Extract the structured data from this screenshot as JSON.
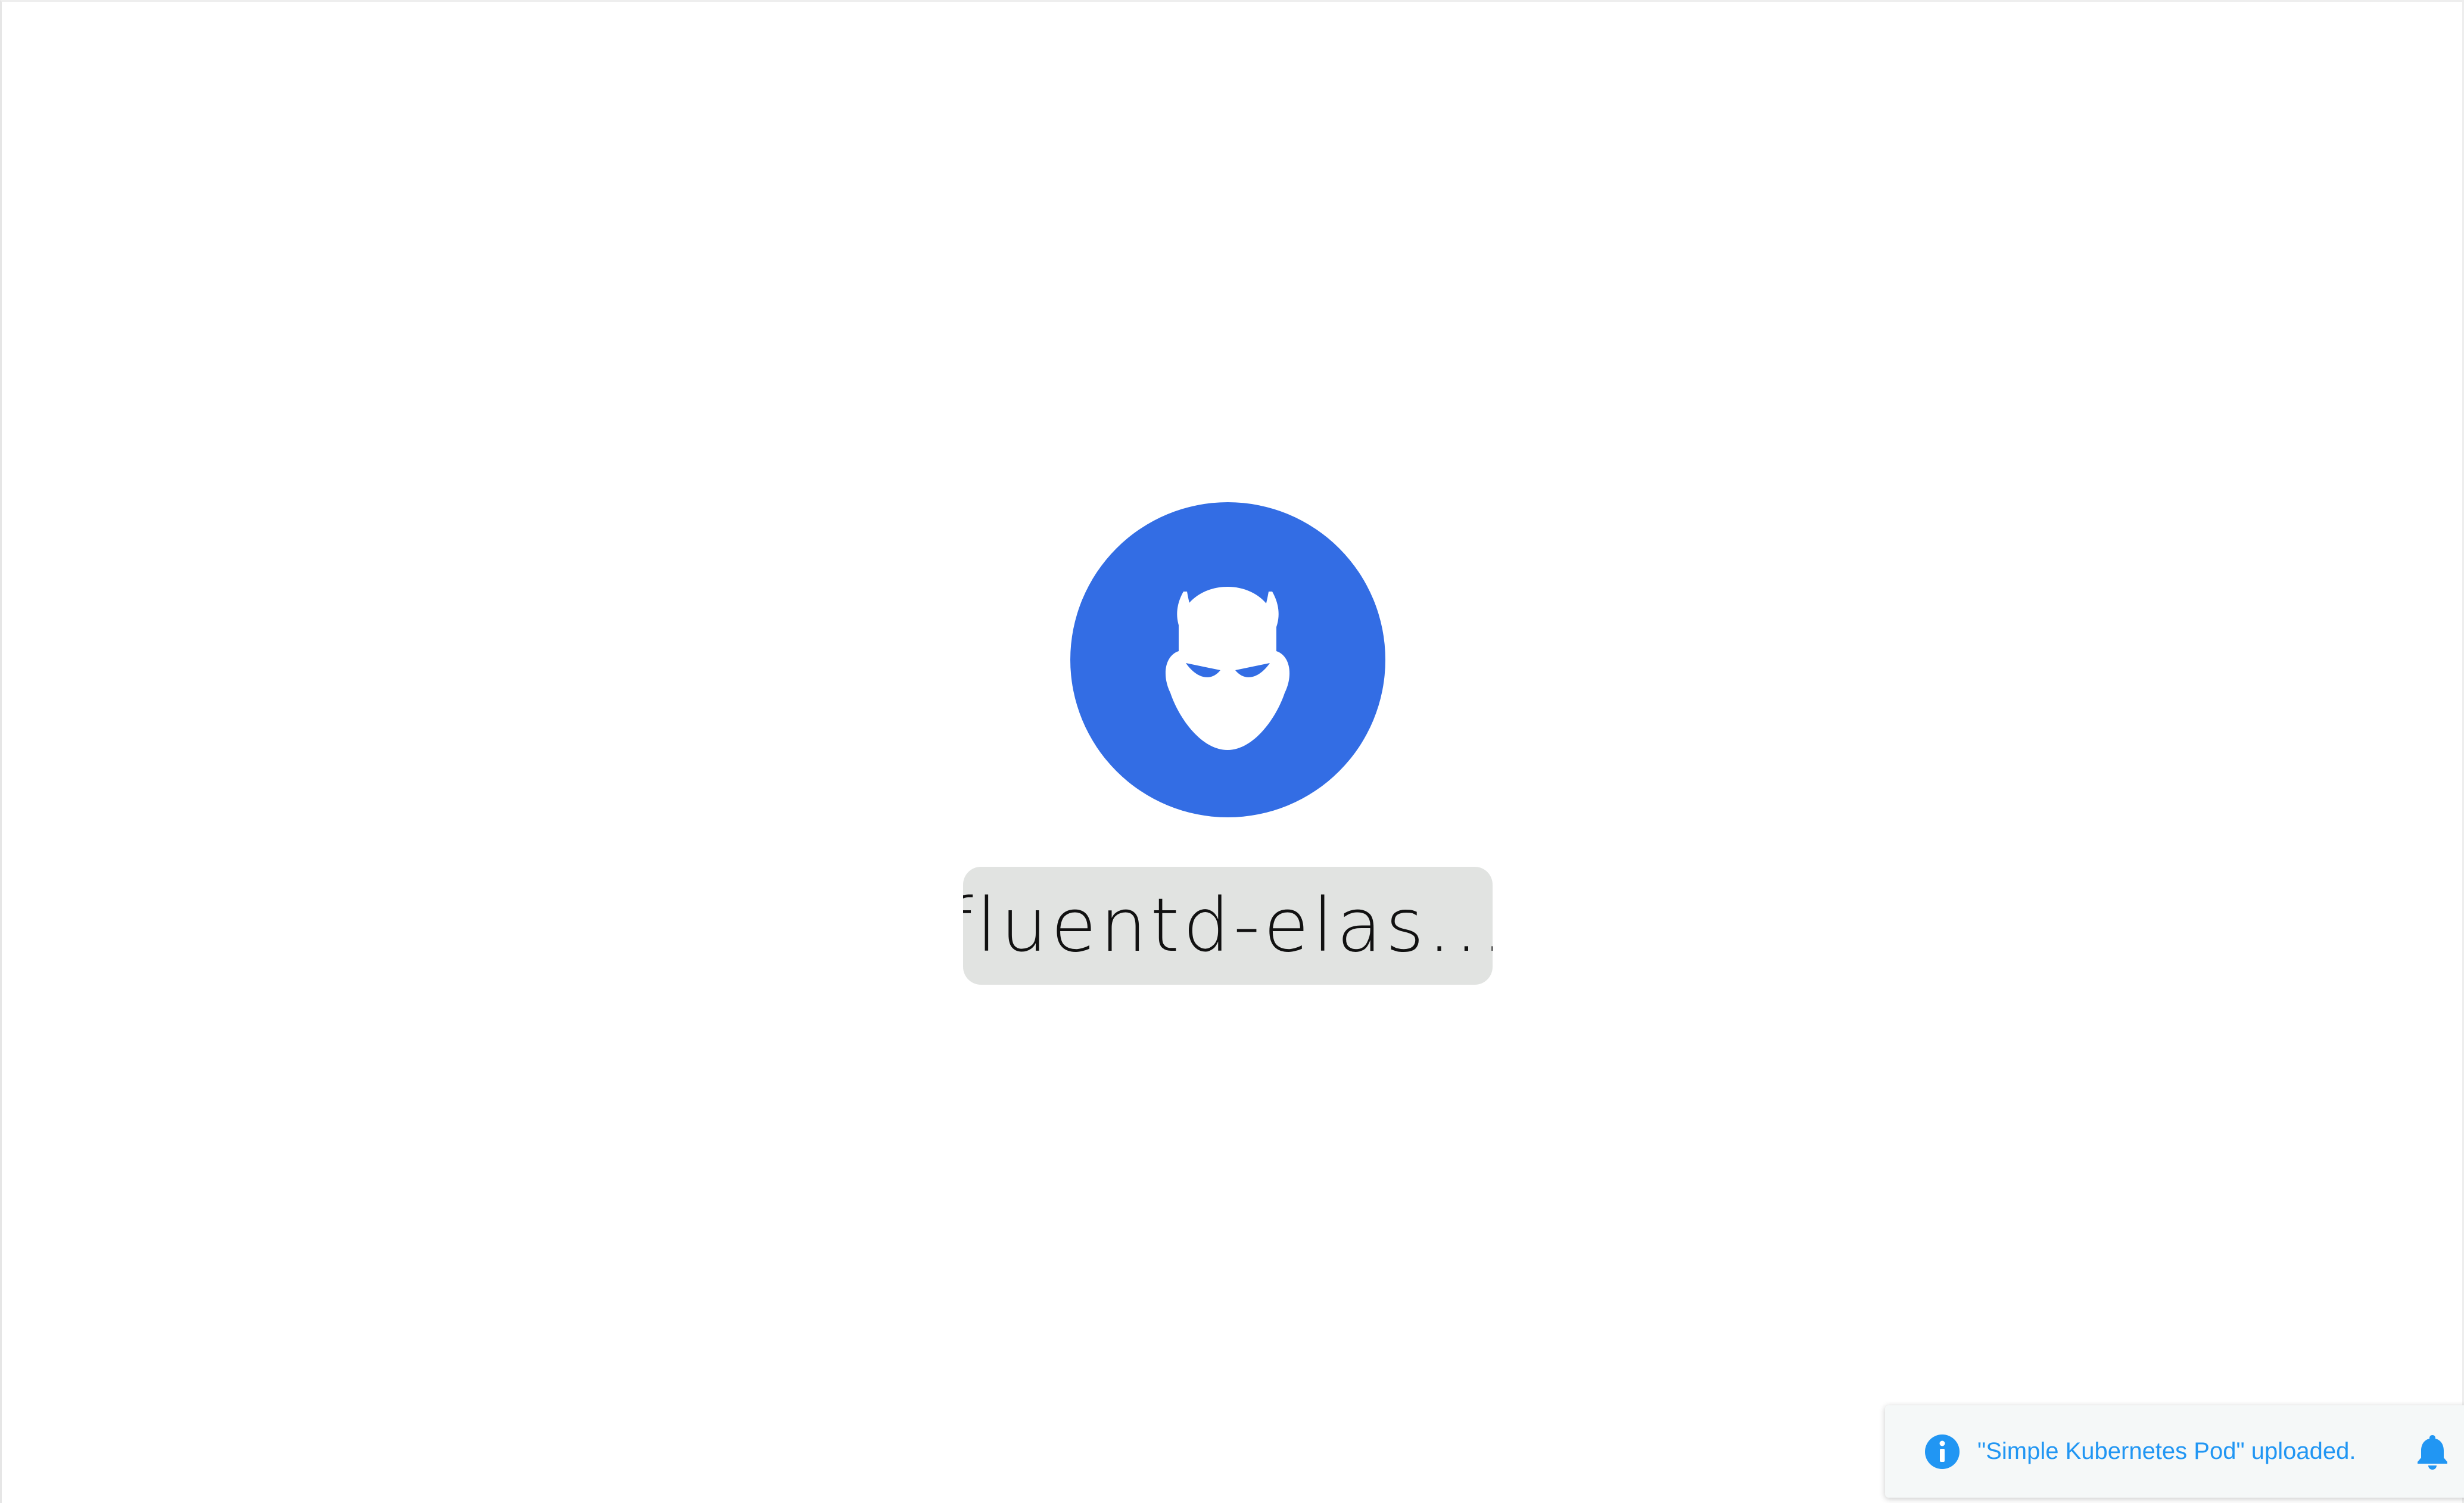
{
  "colors": {
    "background": "#ffffff",
    "node_fill": "#336de4",
    "node_icon": "#ffffff",
    "label_background": "#e1e3e1",
    "label_text": "#111111",
    "toast_background": "#f5f8f8",
    "toast_accent": "#2196f3"
  },
  "node": {
    "icon": "devil-head-icon",
    "label": "fluentd-elas..."
  },
  "notification": {
    "icon": "info-icon",
    "message": "\"Simple Kubernetes Pod\" uploaded.",
    "action_icon": "bell-icon"
  }
}
